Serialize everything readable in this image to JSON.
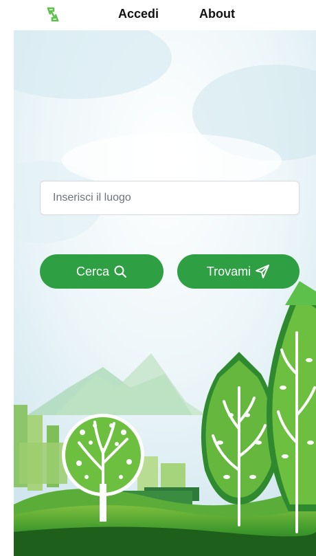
{
  "nav": {
    "logo_icon": "recycle-leaf-icon",
    "login_label": "Accedi",
    "about_label": "About"
  },
  "search": {
    "placeholder": "Inserisci il luogo",
    "value": ""
  },
  "actions": {
    "search_label": "Cerca",
    "search_icon": "search-icon",
    "locate_label": "Trovami",
    "locate_icon": "send-arrow-icon"
  },
  "colors": {
    "accent": "#2ea043",
    "logo": "#5cc04a"
  }
}
